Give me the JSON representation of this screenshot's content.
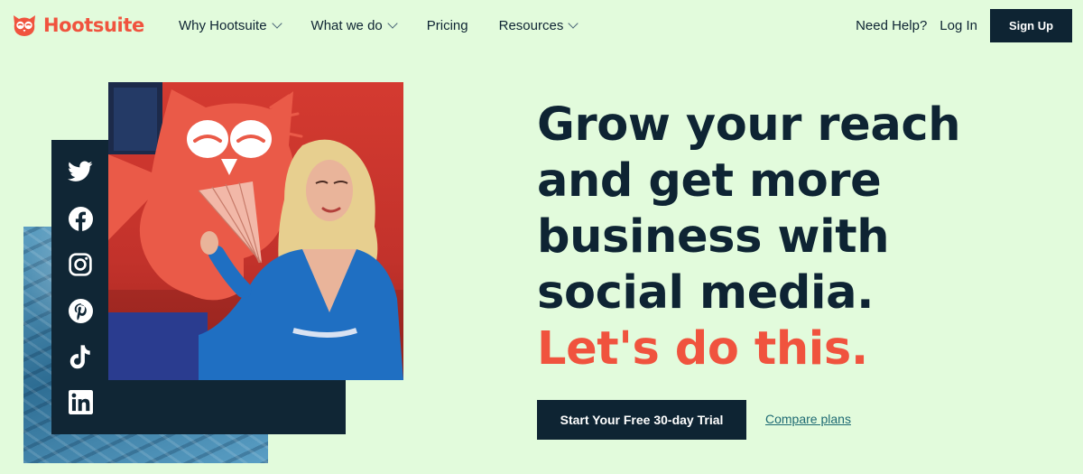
{
  "brand": {
    "name": "Hootsuite",
    "accent_color": "#f0533e",
    "dark_color": "#0e2433",
    "background_color": "#e2fbdc"
  },
  "nav": {
    "items": [
      {
        "label": "Why Hootsuite",
        "has_dropdown": true
      },
      {
        "label": "What we do",
        "has_dropdown": true
      },
      {
        "label": "Pricing",
        "has_dropdown": false
      },
      {
        "label": "Resources",
        "has_dropdown": true
      }
    ],
    "need_help": "Need Help?",
    "login": "Log In",
    "signup": "Sign Up"
  },
  "hero": {
    "headline_lines": [
      "Grow your reach",
      "and get more",
      "business with",
      "social media."
    ],
    "accent_line": "Let's do this.",
    "cta_primary": "Start Your Free 30-day Trial",
    "cta_secondary": "Compare plans",
    "social_icons": [
      "twitter-icon",
      "facebook-icon",
      "instagram-icon",
      "pinterest-icon",
      "tiktok-icon",
      "linkedin-icon"
    ]
  }
}
